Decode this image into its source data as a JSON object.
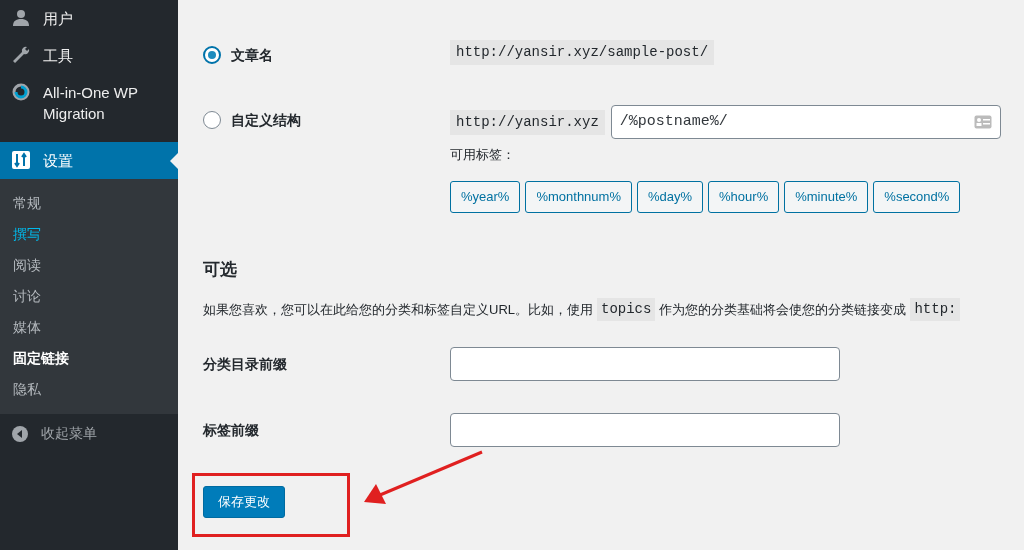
{
  "sidebar": {
    "menu": [
      {
        "label": "用户",
        "selected": false
      },
      {
        "label": "工具",
        "selected": false
      },
      {
        "label": "All-in-One WP Migration",
        "selected": false
      },
      {
        "label": "设置",
        "selected": true
      }
    ],
    "submenu": [
      {
        "label": "常规",
        "selected": false,
        "hovered": false
      },
      {
        "label": "撰写",
        "selected": false,
        "hovered": true
      },
      {
        "label": "阅读",
        "selected": false,
        "hovered": false
      },
      {
        "label": "讨论",
        "selected": false,
        "hovered": false
      },
      {
        "label": "媒体",
        "selected": false,
        "hovered": false
      },
      {
        "label": "固定链接",
        "selected": true,
        "hovered": false
      },
      {
        "label": "隐私",
        "selected": false,
        "hovered": false
      }
    ],
    "collapse": "收起菜单"
  },
  "permalink_options": [
    {
      "label": "文章名",
      "selected": true,
      "prefix": "http://yansir.xyz/sample-post/"
    },
    {
      "label": "自定义结构",
      "selected": false,
      "prefix": "http://yansir.xyz",
      "value": "/%postname%/"
    }
  ],
  "available_tags_label": "可用标签：",
  "tags": [
    "%year%",
    "%monthnum%",
    "%day%",
    "%hour%",
    "%minute%",
    "%second%"
  ],
  "optional": {
    "heading": "可选",
    "description": [
      {
        "kind": "text",
        "text": "如果您喜欢，您可以在此给您的分类和标签自定义URL。比如，使用"
      },
      {
        "kind": "code",
        "text": "topics"
      },
      {
        "kind": "text",
        "text": "作为您的分类基础将会使您的分类链接变成"
      },
      {
        "kind": "code",
        "text": "http:"
      }
    ],
    "fields": [
      {
        "label": "分类目录前缀"
      },
      {
        "label": "标签前缀"
      }
    ]
  },
  "save_button": "保存更改"
}
